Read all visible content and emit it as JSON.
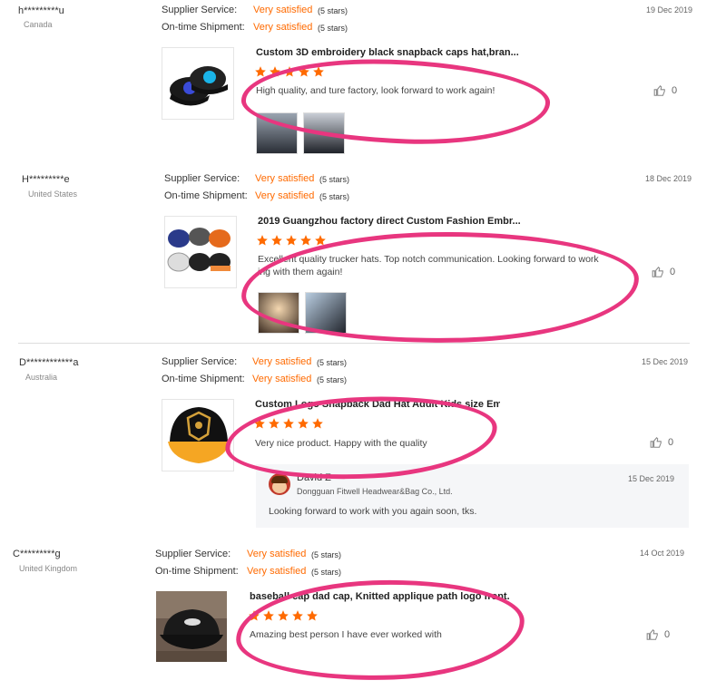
{
  "labels": {
    "supplier_service": "Supplier Service:",
    "ontime_shipment": "On-time Shipment:"
  },
  "colors": {
    "accent": "#ff6a00",
    "highlight": "#e8367f",
    "star": "#ff6a00"
  },
  "reviews": [
    {
      "buyer": "h*********u",
      "country": "Canada",
      "service": "Very satisfied",
      "service_stars": "(5 stars)",
      "shipment": "Very satisfied",
      "shipment_stars": "(5 stars)",
      "date": "19 Dec 2019",
      "product": "Custom 3D embroidery black snapback caps hat,bran...",
      "rating": 5,
      "text": "High quality, and ture factory, look forward to work again!",
      "likes": "0",
      "photos": 2
    },
    {
      "buyer": "H*********e",
      "country": "United States",
      "service": "Very satisfied",
      "service_stars": "(5 stars)",
      "shipment": "Very satisfied",
      "shipment_stars": "(5 stars)",
      "date": "18 Dec 2019",
      "product": "2019 Guangzhou factory direct Custom Fashion Embr...",
      "rating": 5,
      "text": "Excellent quality trucker hats. Top notch communication. Looking forward to work ing with them again!",
      "likes": "0",
      "photos": 2
    },
    {
      "buyer": "D************a",
      "country": "Australia",
      "service": "Very satisfied",
      "service_stars": "(5 stars)",
      "shipment": "Very satisfied",
      "shipment_stars": "(5 stars)",
      "date": "15 Dec 2019",
      "product": "Custom Logo Snapback Dad Hat Adult Kids size Embr...",
      "rating": 5,
      "text": "Very nice product. Happy with the quality",
      "likes": "0",
      "photos": 0,
      "reply": {
        "name": "David Z",
        "company": "Dongguan Fitwell Headwear&Bag Co., Ltd.",
        "date": "15 Dec 2019",
        "text": "Looking forward to work with you again soon, tks."
      }
    },
    {
      "buyer": "C*********g",
      "country": "United Kingdom",
      "service": "Very satisfied",
      "service_stars": "(5 stars)",
      "shipment": "Very satisfied",
      "shipment_stars": "(5 stars)",
      "date": "14 Oct 2019",
      "product": "baseball cap dad cap, Knitted applique path logo front.",
      "rating": 5,
      "text": "Amazing best person I have ever worked with",
      "likes": "0",
      "photos": 0
    }
  ]
}
